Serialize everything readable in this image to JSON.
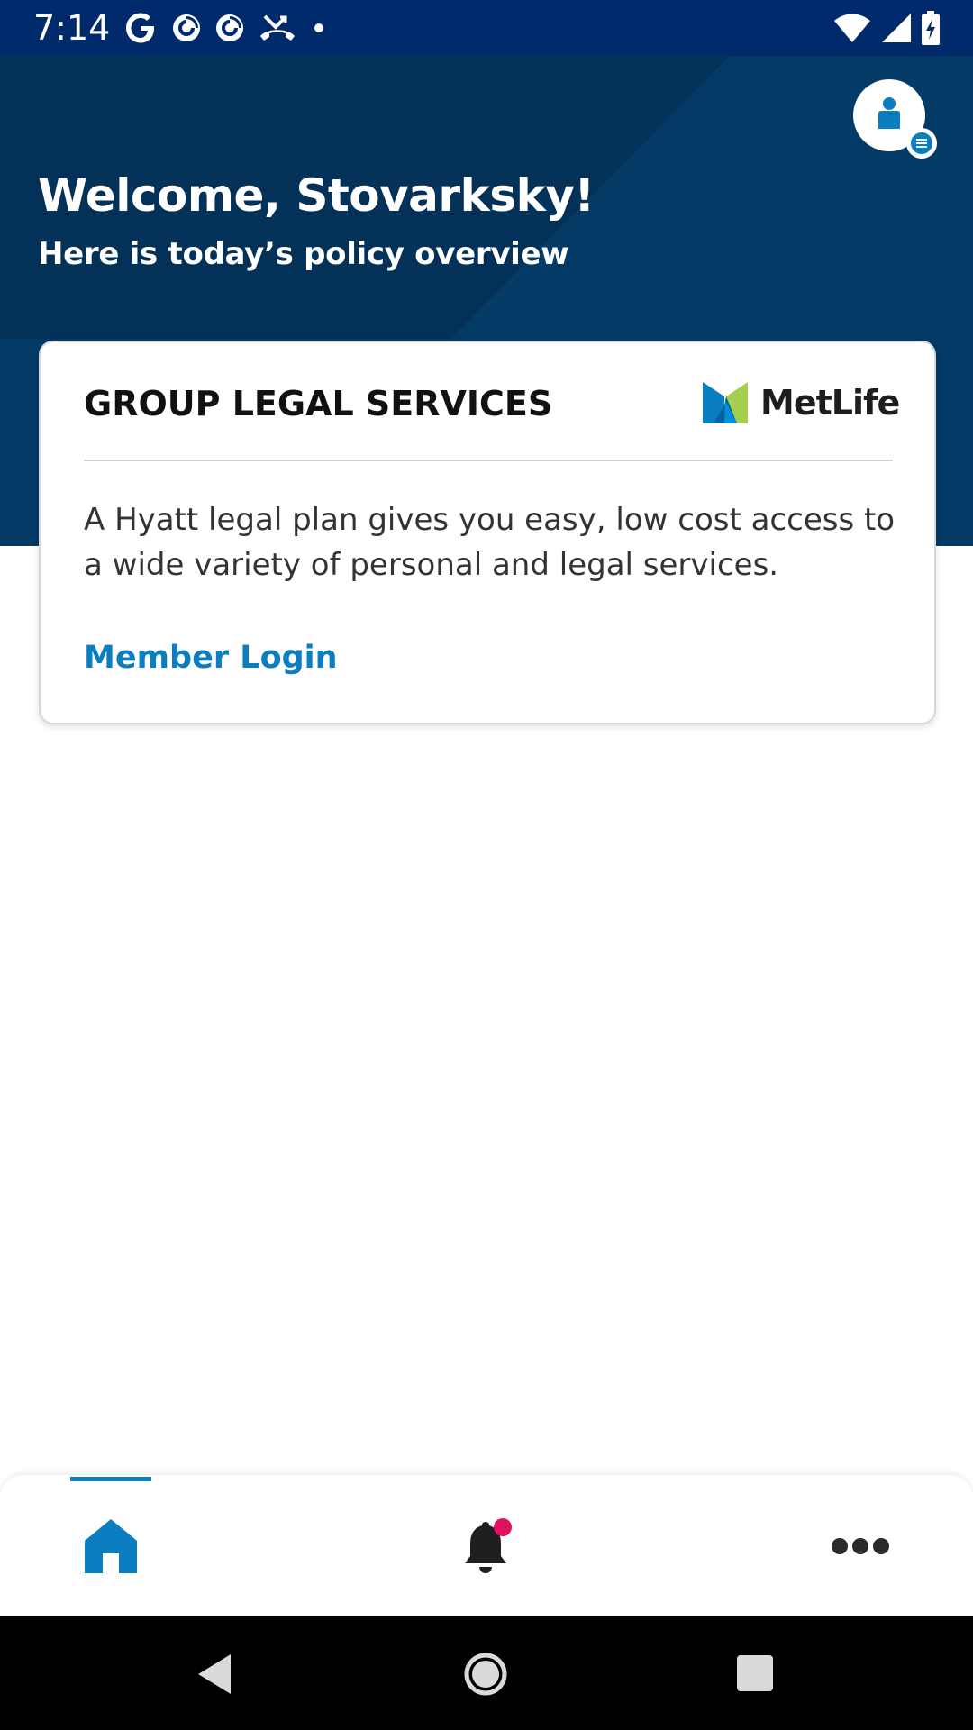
{
  "status_bar": {
    "time": "7:14",
    "left_icons": [
      "google-icon",
      "pocket-casts-icon",
      "pocket-casts-icon",
      "missed-call-icon",
      "dot-icon"
    ],
    "right_icons": [
      "wifi-icon",
      "signal-icon",
      "battery-icon"
    ]
  },
  "hero": {
    "title": "Welcome, Stovarksky!",
    "subtitle": "Here is today’s policy overview",
    "background_color": "#043a66",
    "profile_icon": "profile-icon",
    "profile_badge_icon": "menu-icon"
  },
  "card": {
    "title": "GROUP LEGAL SERVICES",
    "brand_text": "MetLife",
    "description": "A Hyatt legal plan gives you easy, low cost access to a wide variety of personal and legal services.",
    "link_label": "Member Login",
    "link_color": "#0b7dc1"
  },
  "bottom_nav": {
    "items": [
      {
        "icon": "home-icon",
        "active": true
      },
      {
        "icon": "bell-icon",
        "has_badge": true
      },
      {
        "icon": "more-icon"
      }
    ],
    "active_color": "#0b7dc1",
    "badge_color": "#e0115f"
  },
  "system_nav": {
    "buttons": [
      "back-icon",
      "home-circle-icon",
      "recents-icon"
    ]
  }
}
